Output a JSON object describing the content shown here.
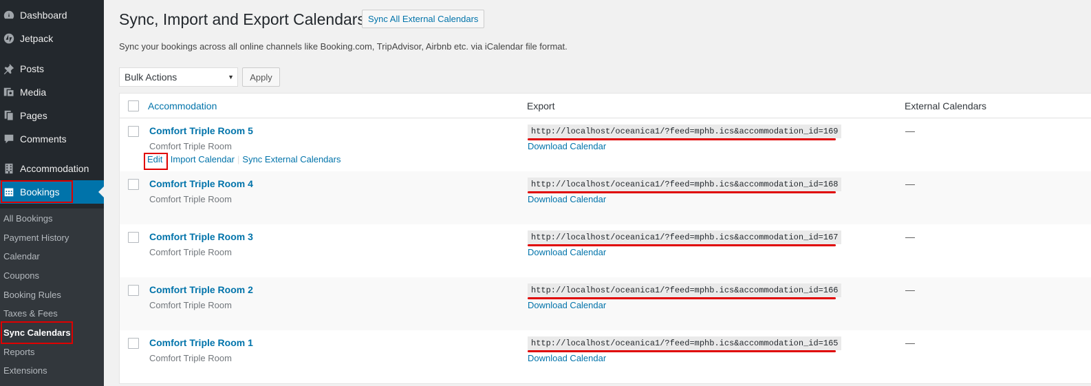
{
  "sidebar": {
    "items": [
      {
        "label": "Dashboard",
        "icon": "dashboard-icon"
      },
      {
        "label": "Jetpack",
        "icon": "jetpack-icon"
      },
      {
        "label": "Posts",
        "icon": "pushpin-icon"
      },
      {
        "label": "Media",
        "icon": "media-icon"
      },
      {
        "label": "Pages",
        "icon": "pages-icon"
      },
      {
        "label": "Comments",
        "icon": "comment-icon"
      },
      {
        "label": "Accommodation",
        "icon": "building-icon"
      },
      {
        "label": "Bookings",
        "icon": "calendar-icon"
      }
    ],
    "submenu": [
      "All Bookings",
      "Payment History",
      "Calendar",
      "Coupons",
      "Booking Rules",
      "Taxes & Fees",
      "Sync Calendars",
      "Reports",
      "Extensions"
    ]
  },
  "page": {
    "title": "Sync, Import and Export Calendars",
    "sync_all_label": "Sync All External Calendars",
    "description": "Sync your bookings across all online channels like Booking.com, TripAdvisor, Airbnb etc. via iCalendar file format.",
    "bulk_actions": "Bulk Actions",
    "apply_label": "Apply"
  },
  "table": {
    "headers": {
      "accommodation": "Accommodation",
      "export": "Export",
      "external": "External Calendars"
    },
    "row_actions": {
      "edit": "Edit",
      "import": "Import Calendar",
      "sync": "Sync External Calendars"
    },
    "download_label": "Download Calendar",
    "empty_mark": "—",
    "rows": [
      {
        "title": "Comfort Triple Room 5",
        "type": "Comfort Triple Room",
        "url": "http://localhost/oceanica1/?feed=mphb.ics&accommodation_id=169"
      },
      {
        "title": "Comfort Triple Room 4",
        "type": "Comfort Triple Room",
        "url": "http://localhost/oceanica1/?feed=mphb.ics&accommodation_id=168"
      },
      {
        "title": "Comfort Triple Room 3",
        "type": "Comfort Triple Room",
        "url": "http://localhost/oceanica1/?feed=mphb.ics&accommodation_id=167"
      },
      {
        "title": "Comfort Triple Room 2",
        "type": "Comfort Triple Room",
        "url": "http://localhost/oceanica1/?feed=mphb.ics&accommodation_id=166"
      },
      {
        "title": "Comfort Triple Room 1",
        "type": "Comfort Triple Room",
        "url": "http://localhost/oceanica1/?feed=mphb.ics&accommodation_id=165"
      }
    ]
  },
  "colors": {
    "accent": "#0073aa",
    "sidebar": "#23282d",
    "highlight": "#e00000"
  }
}
